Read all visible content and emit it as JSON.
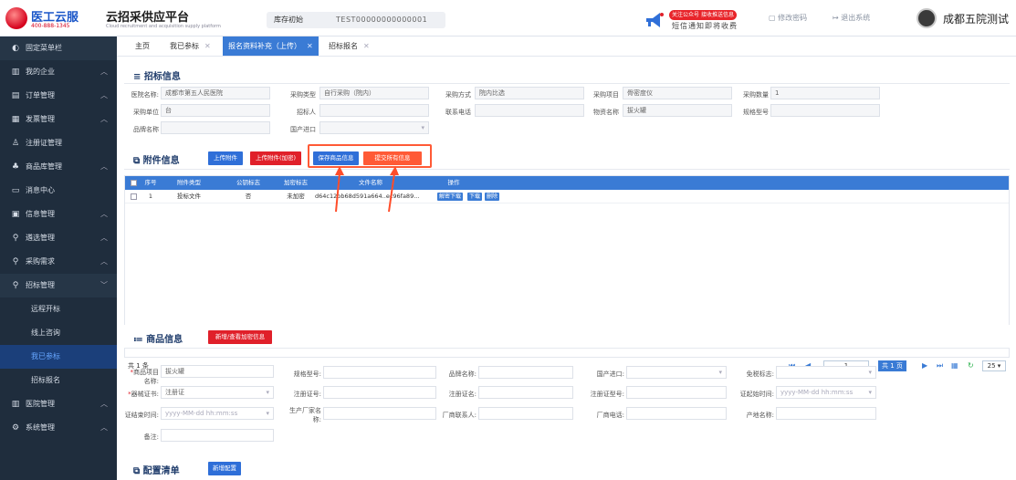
{
  "header": {
    "logo_name": "医工云服",
    "logo_phone": "400-888-1345",
    "platform_title": "云招采供应平台",
    "platform_subtitle": "Cloud recruitment and acquisition supply platform",
    "stock_label": "库存初始",
    "stock_value": "TEST00000000000001",
    "notice_badge": "关注公众号 接收推送信息",
    "notice_text": "短信通知即将收费",
    "change_password": "修改密码",
    "logout": "退出系统",
    "user_name": "成都五院测试"
  },
  "sidebar": {
    "fixed_menu": "固定菜单栏",
    "items": [
      {
        "label": "我的企业",
        "icon": "building-icon"
      },
      {
        "label": "订单管理",
        "icon": "order-icon"
      },
      {
        "label": "发票管理",
        "icon": "invoice-icon"
      },
      {
        "label": "注册证管理",
        "icon": "certificate-icon"
      },
      {
        "label": "商品库管理",
        "icon": "goods-icon"
      },
      {
        "label": "消息中心",
        "icon": "message-icon"
      },
      {
        "label": "信息管理",
        "icon": "info-icon"
      },
      {
        "label": "遴选管理",
        "icon": "select-icon"
      },
      {
        "label": "采购需求",
        "icon": "purchase-icon"
      },
      {
        "label": "招标管理",
        "icon": "bid-icon"
      },
      {
        "label": "远程开标",
        "icon": ""
      },
      {
        "label": "线上咨询",
        "icon": ""
      },
      {
        "label": "我已参标",
        "icon": ""
      },
      {
        "label": "招标报名",
        "icon": ""
      },
      {
        "label": "医院管理",
        "icon": "hospital-icon"
      },
      {
        "label": "系统管理",
        "icon": "settings-icon"
      }
    ]
  },
  "tabs": [
    {
      "label": "主页"
    },
    {
      "label": "我已参标"
    },
    {
      "label": "报名资料补充（上传）"
    },
    {
      "label": "招标报名"
    }
  ],
  "bid_info": {
    "section_title": "招标信息",
    "fields": [
      {
        "label": "医院名称:",
        "value": "成都市第五人民医院"
      },
      {
        "label": "采购类型",
        "value": "自行采购（院内）"
      },
      {
        "label": "采购方式",
        "value": "院内比选"
      },
      {
        "label": "采购项目",
        "value": "骨密度仪"
      },
      {
        "label": "采购数量",
        "value": "1"
      },
      {
        "label": "采购单位",
        "value": "台"
      },
      {
        "label": "招标人",
        "value": ""
      },
      {
        "label": "联系电话",
        "value": ""
      },
      {
        "label": "物资名称",
        "value": "拔火罐"
      },
      {
        "label": "规格型号",
        "value": ""
      },
      {
        "label": "品牌名称",
        "value": ""
      },
      {
        "label": "国产进口",
        "value": ""
      }
    ]
  },
  "attach_info": {
    "section_title": "附件信息",
    "btn_upload": "上传附件",
    "btn_upload_enc": "上传附件(加密)",
    "btn_save": "保存商品信息",
    "btn_submit": "提交所有信息",
    "columns": [
      "序号",
      "附件类型",
      "公钥标志",
      "加密标志",
      "文件名称",
      "操作"
    ],
    "rows": [
      {
        "no": "1",
        "type": "投标文件",
        "pub": "否",
        "enc": "未加密",
        "file": "d64c12bb68d591a664..ec96fa89...",
        "act1": "解密下载",
        "act2": "下载",
        "act3": "删除"
      }
    ],
    "total": "共 1 条",
    "page_input": "1",
    "page_total": "共 1 页",
    "page_size": "25"
  },
  "goods_info": {
    "section_title": "商品信息",
    "btn_add": "新增/查看加密信息",
    "fields": {
      "item_name_label": "商品项目名称:",
      "item_name": "拔火罐",
      "spec_label": "规格型号:",
      "brand_label": "品牌名称:",
      "import_label": "国产进口:",
      "exempt_label": "免税标志:",
      "cert_label": "器械证书:",
      "cert_value": "注册证",
      "cert_no_label": "注册证号:",
      "cert_name_label": "注册证名:",
      "cert_type_label": "注册证型号:",
      "start_label": "证起始时间:",
      "start_ph": "yyyy-MM-dd hh:mm:ss",
      "end_label": "证结束时间:",
      "end_ph": "yyyy-MM-dd hh:mm:ss",
      "maker_label": "生产厂家名称:",
      "contact_label": "厂商联系人:",
      "phone_label": "厂商电话:",
      "origin_label": "产地名称:",
      "remark_label": "备注:"
    }
  },
  "config_list": {
    "section_title": "配置清单",
    "btn_add": "新增配置"
  }
}
